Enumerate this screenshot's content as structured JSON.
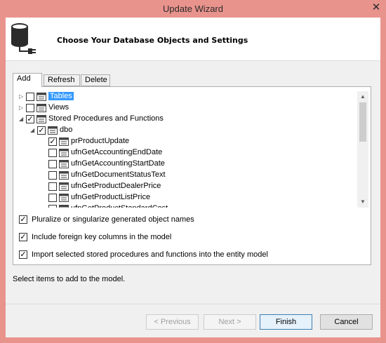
{
  "window": {
    "title": "Update Wizard",
    "close_glyph": "✕"
  },
  "header": {
    "title": "Choose Your Database Objects and Settings"
  },
  "tabs": [
    {
      "label": "Add",
      "active": true
    },
    {
      "label": "Refresh",
      "active": false
    },
    {
      "label": "Delete",
      "active": false
    }
  ],
  "tree": [
    {
      "label": "Tables",
      "checked": false,
      "expanded": false,
      "level": 0,
      "icon": "table-folder-icon",
      "selected": true
    },
    {
      "label": "Views",
      "checked": false,
      "expanded": false,
      "level": 0,
      "icon": "view-folder-icon"
    },
    {
      "label": "Stored Procedures and Functions",
      "checked": true,
      "expanded": true,
      "level": 0,
      "icon": "proc-folder-icon"
    },
    {
      "label": "dbo",
      "checked": true,
      "expanded": true,
      "level": 1,
      "icon": "schema-icon"
    },
    {
      "label": "prProductUpdate",
      "checked": true,
      "level": 2,
      "icon": "procedure-icon"
    },
    {
      "label": "ufnGetAccountingEndDate",
      "checked": false,
      "level": 2,
      "icon": "procedure-icon"
    },
    {
      "label": "ufnGetAccountingStartDate",
      "checked": false,
      "level": 2,
      "icon": "procedure-icon"
    },
    {
      "label": "ufnGetDocumentStatusText",
      "checked": false,
      "level": 2,
      "icon": "procedure-icon"
    },
    {
      "label": "ufnGetProductDealerPrice",
      "checked": false,
      "level": 2,
      "icon": "procedure-icon"
    },
    {
      "label": "ufnGetProductListPrice",
      "checked": false,
      "level": 2,
      "icon": "procedure-icon"
    },
    {
      "label": "ufnGetProductStandardCost",
      "checked": false,
      "level": 2,
      "icon": "procedure-icon"
    }
  ],
  "options": [
    {
      "label": "Pluralize or singularize generated object names",
      "checked": true
    },
    {
      "label": "Include foreign key columns in the model",
      "checked": true
    },
    {
      "label": "Import selected stored procedures and functions into the entity model",
      "checked": true
    }
  ],
  "status": "Select items to add to the model.",
  "buttons": {
    "previous": "< Previous",
    "next": "Next >",
    "finish": "Finish",
    "cancel": "Cancel"
  },
  "colors": {
    "frame": "#e9938d",
    "selection": "#3399ff"
  }
}
